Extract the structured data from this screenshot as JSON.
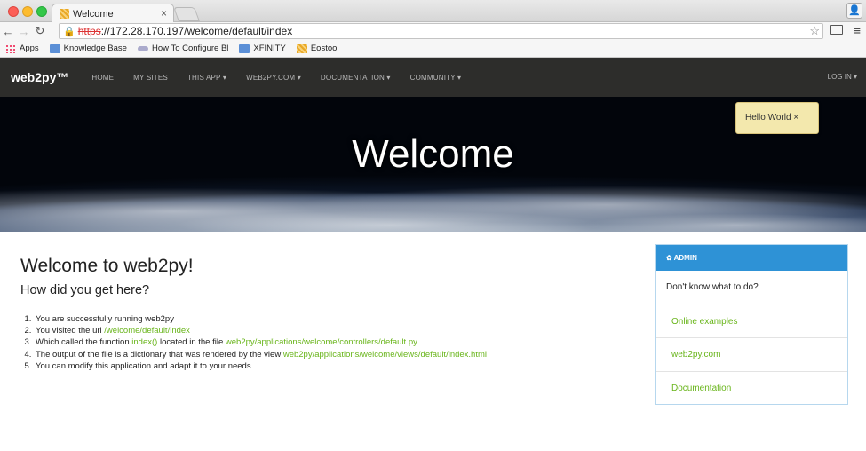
{
  "browser": {
    "tab_title": "Welcome",
    "tab_close": "×",
    "url_scheme": "https",
    "url_rest": "://172.28.170.197/welcome/default/index",
    "bookmarks": [
      {
        "label": "Apps",
        "icon": "apps-grid-icon"
      },
      {
        "label": "Knowledge Base",
        "icon": "folder-icon"
      },
      {
        "label": "How To Configure Bl",
        "icon": "cloud-icon"
      },
      {
        "label": "XFINITY",
        "icon": "folder-icon"
      },
      {
        "label": "Eostool",
        "icon": "favicon-icon"
      }
    ]
  },
  "navbar": {
    "brand": "web2py™",
    "items": [
      "HOME",
      "MY SITES",
      "THIS APP ▾",
      "WEB2PY.COM ▾",
      "DOCUMENTATION ▾",
      "COMMUNITY ▾"
    ],
    "login": "LOG IN ▾"
  },
  "hero": {
    "title": "Welcome",
    "flash": "Hello World ×"
  },
  "main": {
    "heading": "Welcome to web2py!",
    "subheading": "How did you get here?",
    "steps": [
      {
        "text": "You are successfully running web2py"
      },
      {
        "text": "You visited the url ",
        "link": "/welcome/default/index"
      },
      {
        "text": "Which called the function ",
        "link": "index()",
        "text2": " located in the file ",
        "link2": "web2py/applications/welcome/controllers/default.py"
      },
      {
        "text": "The output of the file is a dictionary that was rendered by the view ",
        "link": "web2py/applications/welcome/views/default/index.html"
      },
      {
        "text": "You can modify this application and adapt it to your needs"
      }
    ]
  },
  "sidebar": {
    "header": "✿ ADMIN",
    "intro": "Don't know what to do?",
    "links": [
      "Online examples",
      "web2py.com",
      "Documentation"
    ]
  },
  "colors": {
    "link": "#69b51b",
    "sidebar_header": "#2e92d6",
    "navbar": "#2d2d2b",
    "flash": "#f3e8ad"
  }
}
